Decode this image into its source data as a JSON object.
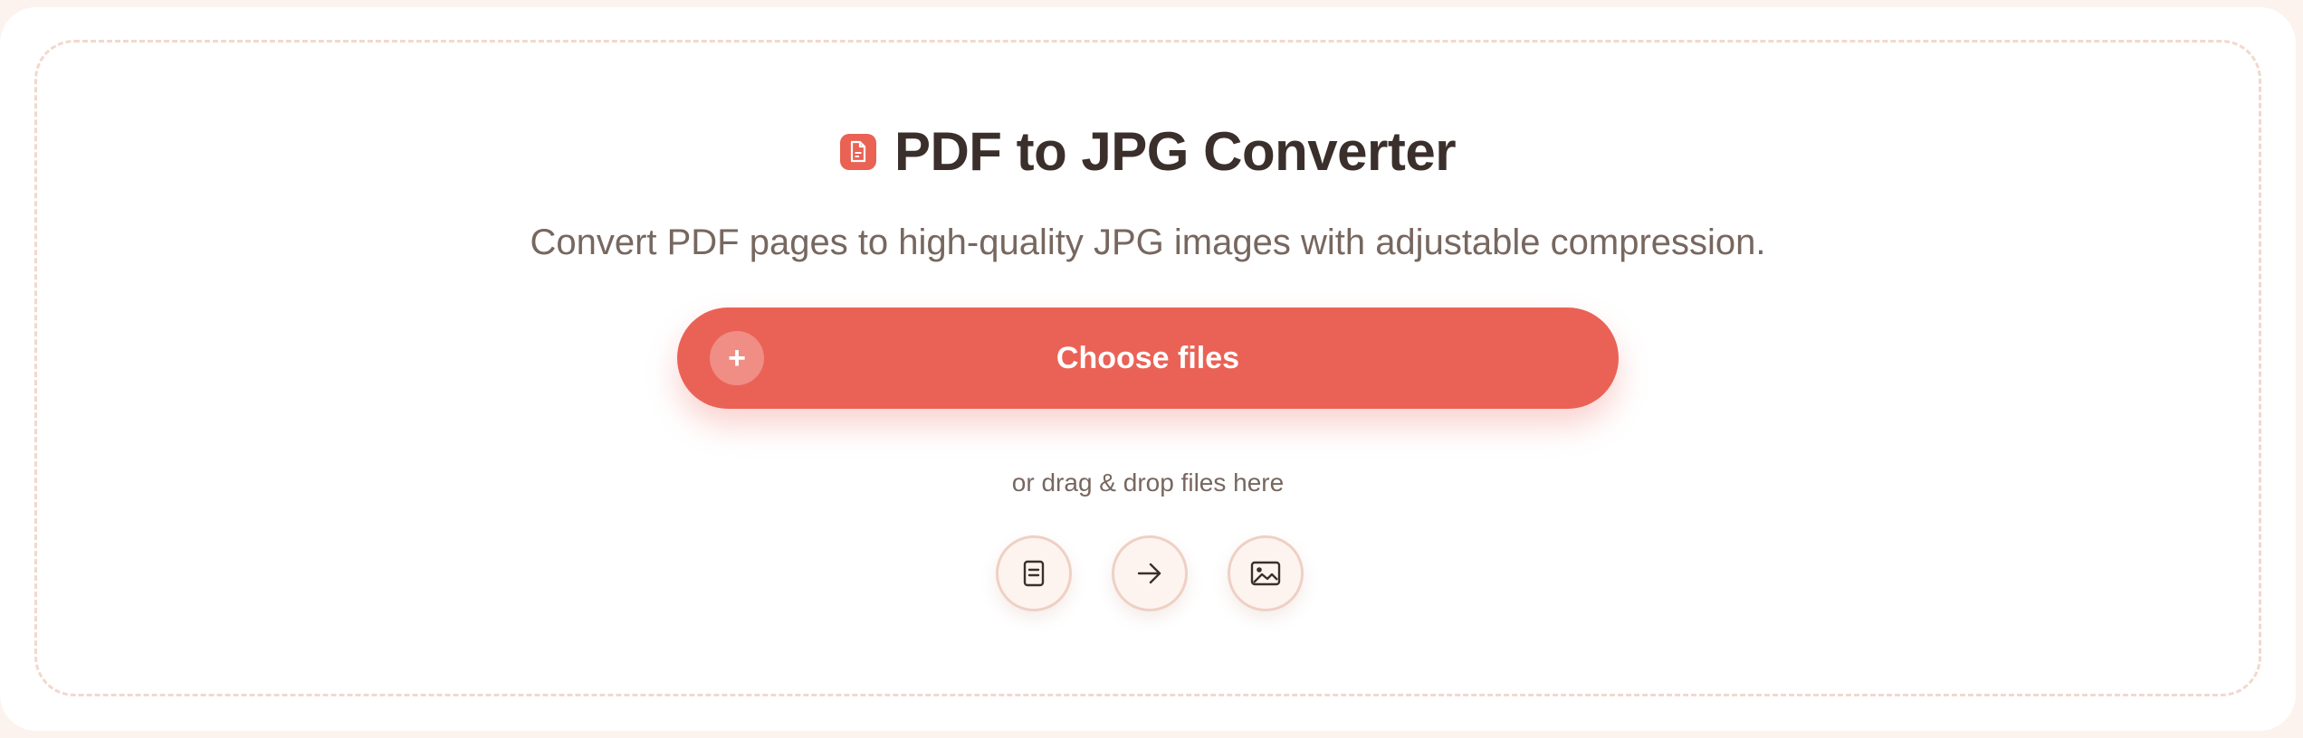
{
  "header": {
    "title": "PDF to JPG Converter",
    "title_icon": "pdf-document-icon",
    "subtitle": "Convert PDF pages to high-quality JPG images with adjustable compression."
  },
  "upload": {
    "choose_label": "Choose files",
    "choose_icon": "plus-icon",
    "plus_glyph": "+",
    "drag_hint": "or drag & drop files here"
  },
  "steps": [
    {
      "icon": "document-icon"
    },
    {
      "icon": "arrow-right-icon"
    },
    {
      "icon": "image-icon"
    }
  ],
  "colors": {
    "accent": "#ea6256",
    "background": "#fcf3ef",
    "title_text": "#3b2f2c",
    "muted_text": "#77675f",
    "dash_border": "#f2d8ce"
  }
}
